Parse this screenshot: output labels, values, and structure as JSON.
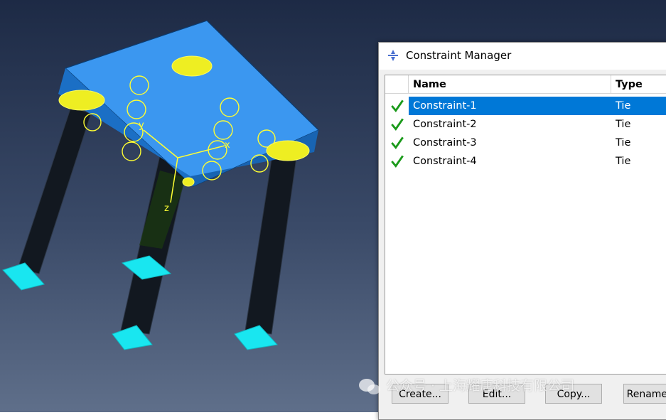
{
  "dialog": {
    "title": "Constraint Manager",
    "columns": [
      "Name",
      "Type"
    ],
    "rows": [
      {
        "name": "Constraint-1",
        "type": "Tie",
        "status": "check-icon",
        "selected": true
      },
      {
        "name": "Constraint-2",
        "type": "Tie",
        "status": "check-icon",
        "selected": false
      },
      {
        "name": "Constraint-3",
        "type": "Tie",
        "status": "check-icon",
        "selected": false
      },
      {
        "name": "Constraint-4",
        "type": "Tie",
        "status": "check-icon",
        "selected": false
      }
    ],
    "buttons": {
      "create": "Create...",
      "edit": "Edit...",
      "copy": "Copy...",
      "rename": "Rename..."
    }
  },
  "triad": {
    "x": "x",
    "y": "y",
    "z": "z"
  },
  "watermark": {
    "text": "公众号 · 上海耀唐科技有限公司"
  },
  "colors": {
    "selection": "#0078d7",
    "check": "#1a9a1a",
    "slab": "#1e86ea",
    "constraint": "#ffff33",
    "bc": "#19e6f0"
  }
}
